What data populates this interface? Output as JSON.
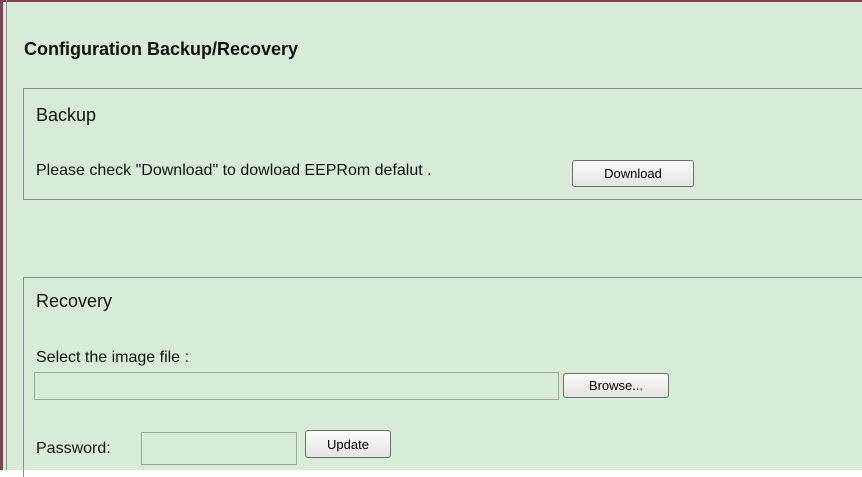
{
  "page": {
    "title": "Configuration Backup/Recovery"
  },
  "backup": {
    "heading": "Backup",
    "instruction": "Please check \"Download\" to dowload EEPRom defalut .",
    "download_label": "Download"
  },
  "recovery": {
    "heading": "Recovery",
    "file_label": "Select the image file :",
    "file_value": "",
    "browse_label": "Browse...",
    "password_label": "Password:",
    "password_value": "",
    "update_label": "Update"
  }
}
